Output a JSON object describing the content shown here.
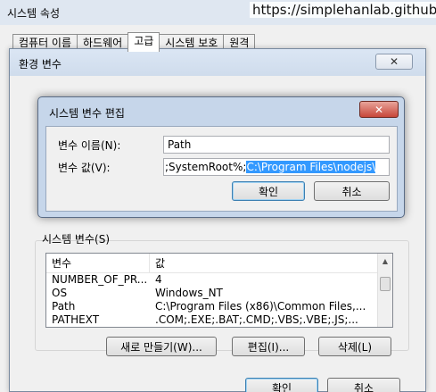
{
  "system_properties": {
    "title": "시스템 속성",
    "watermark": "https://simplehanlab.github.io",
    "tabs": [
      "컴퓨터 이름",
      "하드웨어",
      "고급",
      "시스템 보호",
      "원격"
    ],
    "active_tab": "고급"
  },
  "env_dialog": {
    "title": "환경 변수",
    "close_icon": "close-icon",
    "system_vars_label": "시스템 변수(S)",
    "columns": [
      "변수",
      "값"
    ],
    "rows": [
      {
        "name": "NUMBER_OF_PR...",
        "value": "4"
      },
      {
        "name": "OS",
        "value": "Windows_NT"
      },
      {
        "name": "Path",
        "value": "C:\\Program Files (x86)\\Common Files,..."
      },
      {
        "name": "PATHEXT",
        "value": ".COM;.EXE;.BAT;.CMD;.VBS;.VBE;.JS;..."
      }
    ],
    "buttons": {
      "new": "새로 만들기(W)...",
      "edit": "편집(I)...",
      "delete": "삭제(L)",
      "ok": "확인",
      "cancel": "취소"
    }
  },
  "edit_dialog": {
    "title": "시스템 변수 편집",
    "name_label": "변수 이름(N):",
    "name_value": "Path",
    "value_label": "변수 값(V):",
    "value_prefix": ";SystemRoot%;",
    "value_selected": "C:\\Program Files\\nodejs\\",
    "ok": "확인",
    "cancel": "취소"
  },
  "colors": {
    "selection": "#3399ff",
    "close_button": "#c8473a",
    "dialog_frame": "#c6d6ea"
  }
}
